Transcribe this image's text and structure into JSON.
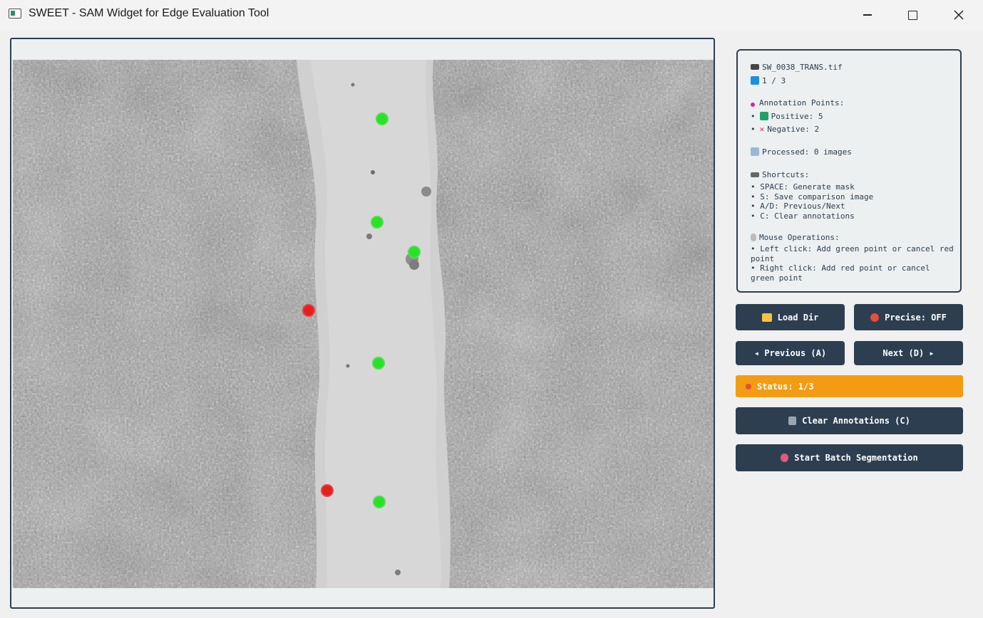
{
  "window": {
    "title": "SWEET - SAM Widget for Edge Evaluation Tool",
    "icon": "app-window-icon",
    "controls": [
      "minimize-icon",
      "maximize-icon",
      "close-icon"
    ]
  },
  "canvas": {
    "image_description_icon": "microscopy-image",
    "points": {
      "positive_color": "#22e622",
      "negative_color": "#e61e1e"
    }
  },
  "info": {
    "file_name": "SW_0038_TRANS.tif",
    "index": "1 / 3",
    "annotation_header": "Annotation Points:",
    "positive": "• ✅ Positive: 5",
    "positive_label": "Positive: 5",
    "negative_label": "Negative: 2",
    "processed": "Processed: 0 images",
    "shortcuts_header": "Shortcuts:",
    "shortcuts": [
      "• SPACE: Generate mask",
      "• S: Save comparison image",
      "• A/D: Previous/Next",
      "• C: Clear annotations"
    ],
    "mouse_header": "Mouse Operations:",
    "mouse": [
      "• Left click: Add green point or cancel red point",
      "• Right click: Add red point or cancel green point"
    ]
  },
  "buttons": {
    "load_dir": "Load Dir",
    "precise": "Precise: OFF",
    "previous": "◂ Previous (A)",
    "next": "Next (D) ▸",
    "clear": "Clear Annotations (C)",
    "batch": "Start Batch Segmentation"
  },
  "status": {
    "text": "Status: 1/3",
    "color": "#f39c12"
  },
  "colors": {
    "panel_border": "#2c3e50",
    "button_bg": "#2c3e50",
    "panel_bg": "#ecf0f1"
  }
}
